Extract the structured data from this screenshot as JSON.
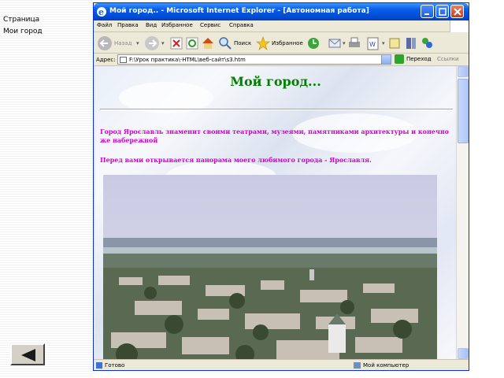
{
  "slide": {
    "side_line1": "Страница",
    "side_line2": "Мои город",
    "back_button_icon": "left-triangle-icon"
  },
  "window": {
    "title": "Мой город.. - Microsoft Internet Explorer - [Автономная работа]",
    "menu": [
      "Файл",
      "Правка",
      "Вид",
      "Избранное",
      "Сервис",
      "Справка"
    ],
    "toolbar": {
      "back_label": "Назад",
      "search_label": "Поиск",
      "favorites_label": "Избранное"
    },
    "address": {
      "label": "Адрес:",
      "value": "F:\\Урок практика\\-HTML\\веб-сайт\\s3.htm",
      "go_label": "Переход",
      "links_label": "Ссылки"
    },
    "status": {
      "text": "Готово",
      "zone": "Мой компьютер"
    }
  },
  "page": {
    "heading": "Мой город...",
    "paragraph1": "Город Ярославль знаменит своими театрами, музеями, памятниками архитектуры и конечно же набережной",
    "paragraph2": "Перед вами открывается панорама моего любимого города - Ярославля."
  },
  "colors": {
    "heading": "#008000",
    "paragraph": "#d400d4",
    "titlebar": "#0a5ee8"
  }
}
